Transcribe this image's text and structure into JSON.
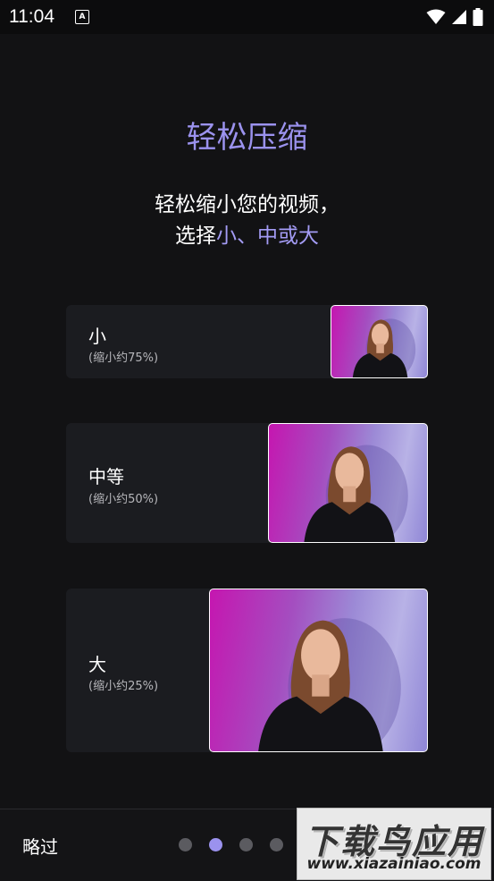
{
  "status_bar": {
    "time": "11:04",
    "notification_icon": "A"
  },
  "onboarding": {
    "title": "轻松压缩",
    "subtitle_line1": "轻松缩小您的视频，",
    "subtitle_line2_prefix": "选择",
    "subtitle_line2_accent": "小、中或大",
    "options": [
      {
        "label": "小",
        "sub": "(缩小约75%)"
      },
      {
        "label": "中等",
        "sub": "(缩小约50%)"
      },
      {
        "label": "大",
        "sub": "(缩小约25%)"
      }
    ],
    "accent_color": "#9b92ee"
  },
  "bottom": {
    "skip_label": "略过",
    "page_count": 4,
    "active_page": 2
  },
  "watermark": {
    "main": "下载鸟应用",
    "url": "www.xiazainiao.com"
  }
}
